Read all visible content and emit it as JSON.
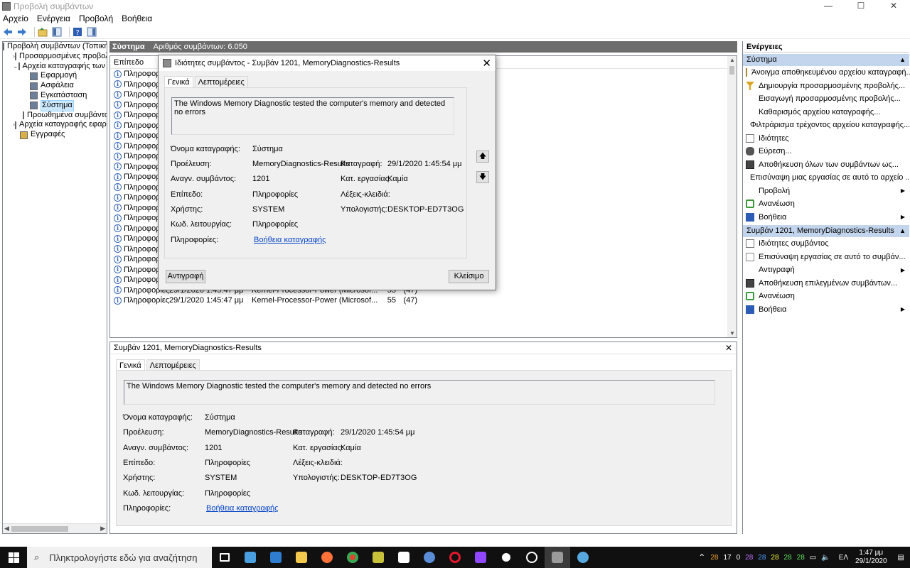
{
  "window": {
    "title": "Προβολή συμβάντων",
    "min": "—",
    "max": "☐",
    "close": "✕"
  },
  "menu": [
    "Αρχείο",
    "Ενέργεια",
    "Προβολή",
    "Βοήθεια"
  ],
  "tree": {
    "items": [
      {
        "label": "Προβολή συμβάντων (Τοπική)",
        "exp": "",
        "indent": 0
      },
      {
        "label": "Προσαρμοσμένες προβολές",
        "exp": "›",
        "indent": 1
      },
      {
        "label": "Αρχεία καταγραφής των Wi",
        "exp": "⌄",
        "indent": 1
      },
      {
        "label": "Εφαρμογή",
        "exp": "",
        "indent": 2
      },
      {
        "label": "Ασφάλεια",
        "exp": "",
        "indent": 2
      },
      {
        "label": "Εγκατάσταση",
        "exp": "",
        "indent": 2
      },
      {
        "label": "Σύστημα",
        "exp": "",
        "indent": 2,
        "selected": true
      },
      {
        "label": "Προωθημένα συμβάντα",
        "exp": "",
        "indent": 2
      },
      {
        "label": "Αρχεία καταγραφής εφαρμ",
        "exp": "›",
        "indent": 1
      },
      {
        "label": "Εγγραφές",
        "exp": "",
        "indent": 1
      }
    ]
  },
  "center": {
    "header_title": "Σύστημα",
    "header_count": "Αριθμός συμβάντων: 6.050",
    "column_level": "Επίπεδο",
    "rows_partial_label": "Πληροφορί",
    "rows_partial_count": 18,
    "rows_full": [
      {
        "level": "Πληροφορίες",
        "date": "29/1/2020 1:45:47 μμ",
        "source": "Kernel-Processor-Power (Microsof...",
        "id": "55",
        "task": "(47)"
      },
      {
        "level": "Πληροφορίες",
        "date": "29/1/2020 1:45:47 μμ",
        "source": "Kernel-Processor-Power (Microsof...",
        "id": "55",
        "task": "(47)"
      },
      {
        "level": "Πληροφορίες",
        "date": "29/1/2020 1:45:47 μμ",
        "source": "Kernel-Processor-Power (Microsof...",
        "id": "55",
        "task": "(47)"
      },
      {
        "level": "Πληροφορίες",
        "date": "29/1/2020 1:45:47 μμ",
        "source": "Kernel-Processor-Power (Microsof...",
        "id": "55",
        "task": "(47)"
      },
      {
        "level": "Πληροφορίες",
        "date": "29/1/2020 1:45:47 μμ",
        "source": "Kernel-Processor-Power (Microsof...",
        "id": "55",
        "task": "(47)"
      }
    ]
  },
  "event": {
    "title": "Συμβάν 1201, MemoryDiagnostics-Results",
    "tab_general": "Γενικά",
    "tab_details": "Λεπτομέρειες",
    "description": "The Windows Memory Diagnostic tested the computer's memory and detected no errors",
    "log_name_label": "Όνομα καταγραφής:",
    "log_name": "Σύστημα",
    "source_label": "Προέλευση:",
    "source": "MemoryDiagnostics-Results",
    "logged_label": "Καταγραφή:",
    "logged": "29/1/2020 1:45:54 μμ",
    "event_id_label": "Αναγν. συμβάντος:",
    "event_id": "1201",
    "task_label": "Κατ. εργασίας:",
    "task": "Καμία",
    "level_label": "Επίπεδο:",
    "level": "Πληροφορίες",
    "keywords_label": "Λέξεις-κλειδιά:",
    "keywords": "",
    "user_label": "Χρήστης:",
    "user": "SYSTEM",
    "computer_label": "Υπολογιστής:",
    "computer": "DESKTOP-ED7T3OG",
    "opcode_label": "Κωδ. λειτουργίας:",
    "opcode": "Πληροφορίες",
    "info_label": "Πληροφορίες:",
    "info_link": "Βοήθεια καταγραφής"
  },
  "dialog": {
    "title": "Ιδιότητες συμβάντος - Συμβάν 1201, MemoryDiagnostics-Results",
    "copy_button": "Αντιγραφή",
    "close_button": "Κλείσιμο",
    "close_glyph": "✕"
  },
  "actions": {
    "title": "Ενέργειες",
    "section1": "Σύστημα",
    "items1": [
      {
        "label": "Άνοιγμα αποθηκευμένου αρχείου καταγραφή...",
        "icon": "folder-open-icon",
        "sub": false
      },
      {
        "label": "Δημιουργία προσαρμοσμένης προβολής...",
        "icon": "filter-icon",
        "sub": false
      },
      {
        "label": "Εισαγωγή προσαρμοσμένης προβολής...",
        "icon": "",
        "sub": false
      },
      {
        "label": "Καθαρισμός αρχείου καταγραφής...",
        "icon": "",
        "sub": false
      },
      {
        "label": "Φιλτράρισμα τρέχοντος αρχείου καταγραφής...",
        "icon": "filter-icon",
        "sub": false
      },
      {
        "label": "Ιδιότητες",
        "icon": "properties-icon",
        "sub": false
      },
      {
        "label": "Εύρεση...",
        "icon": "binoculars-icon",
        "sub": false
      },
      {
        "label": "Αποθήκευση όλων των συμβάντων ως...",
        "icon": "save-icon",
        "sub": false
      },
      {
        "label": "Επισύναψη μιας εργασίας σε αυτό το αρχείο ...",
        "icon": "",
        "sub": false
      },
      {
        "label": "Προβολή",
        "icon": "",
        "sub": true
      },
      {
        "label": "Ανανέωση",
        "icon": "refresh-icon",
        "sub": false
      },
      {
        "label": "Βοήθεια",
        "icon": "help-icon",
        "sub": true
      }
    ],
    "section2": "Συμβάν 1201, MemoryDiagnostics-Results",
    "items2": [
      {
        "label": "Ιδιότητες συμβάντος",
        "icon": "properties-icon",
        "sub": false
      },
      {
        "label": "Επισύναψη εργασίας σε αυτό το συμβάν...",
        "icon": "task-icon",
        "sub": false
      },
      {
        "label": "Αντιγραφή",
        "icon": "copy-icon",
        "sub": true
      },
      {
        "label": "Αποθήκευση επιλεγμένων συμβάντων...",
        "icon": "save-icon",
        "sub": false
      },
      {
        "label": "Ανανέωση",
        "icon": "refresh-icon",
        "sub": false
      },
      {
        "label": "Βοήθεια",
        "icon": "help-icon",
        "sub": true
      }
    ],
    "collapse_glyph": "▲"
  },
  "taskbar": {
    "search_placeholder": "Πληκτρολογήστε εδώ για αναζήτηση",
    "tray_numbers": [
      "28",
      "17",
      "0",
      "28",
      "28",
      "28",
      "28",
      "28"
    ],
    "lang": "ΕΛ",
    "time": "1:47 μμ",
    "date": "29/1/2020"
  },
  "colors": {
    "accent": "#0078d7",
    "section": "#c3d5ec",
    "header": "#6d6d6d"
  }
}
